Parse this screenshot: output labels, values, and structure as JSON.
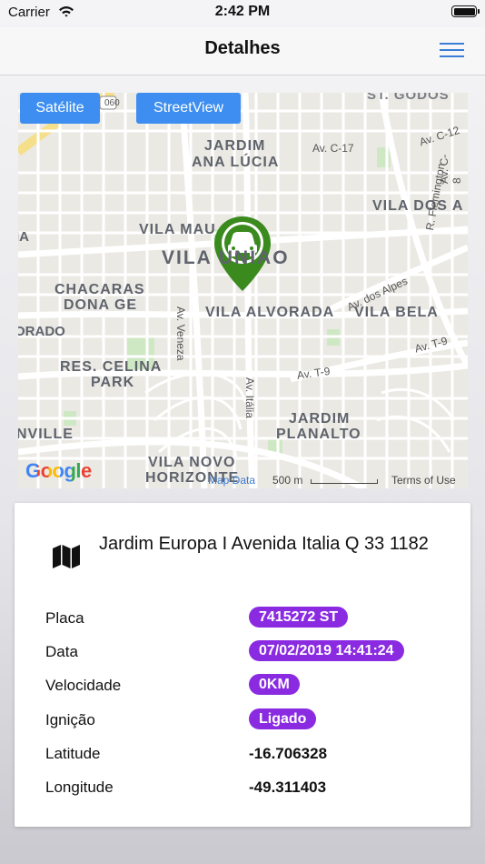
{
  "status_bar": {
    "carrier": "Carrier",
    "time": "2:42 PM"
  },
  "nav": {
    "title": "Detalhes"
  },
  "map": {
    "satellite_label": "Satélite",
    "streetview_label": "StreetView",
    "google_logo": "Google",
    "map_data": "Map Data",
    "scale": "500 m",
    "terms": "Terms of Use",
    "labels": {
      "jardim_ana_lucia_1": "JARDIM",
      "jardim_ana_lucia_2": "ANA LÚCIA",
      "vila_mau": "VILA MAU",
      "vila_uniao": "VILA UNIAO",
      "chacaras_1": "CHACARAS",
      "chacaras_2": "DONA GE",
      "vila_alvorada": "VILA ALVORADA",
      "vila_bela": "VILA BELA",
      "vila_dos_a": "VILA DOS A",
      "orado": "ORADO",
      "res_celina_1": "RES. CELINA",
      "res_celina_2": "PARK",
      "jardim_planalto_1": "JARDIM",
      "jardim_planalto_2": "PLANALTO",
      "nville": "NVILLE",
      "vila_novo_1": "VILA NOVO",
      "vila_novo_2": "HORIZONTE",
      "av_c17": "Av. C-17",
      "av_c12": "Av. C-12",
      "av_c8": "Av. C-8",
      "av_dos_alpes": "Av. dos Alpes",
      "r_flemington": "R. Flemington",
      "av_t9_1": "Av. T-9",
      "av_t9_2": "Av. T-9",
      "av_veneza": "Av. Veneza",
      "av_italia": "Av. Itália",
      "road_060": "060",
      "st_godoi": "ST. GODOS",
      "ia": "IA"
    }
  },
  "details": {
    "address": "Jardim Europa I Avenida Italia Q 33 1182",
    "rows": [
      {
        "label": "Placa",
        "value": "7415272 ST"
      },
      {
        "label": "Data",
        "value": "07/02/2019 14:41:24"
      },
      {
        "label": "Velocidade",
        "value": "0KM"
      },
      {
        "label": "Ignição",
        "value": "Ligado"
      },
      {
        "label": "Latitude",
        "value": "-16.706328"
      },
      {
        "label": "Longitude",
        "value": "-49.311403"
      }
    ]
  },
  "colors": {
    "accent": "#3d8ef0",
    "pill": "#8a2be2",
    "marker": "#3a8a1e"
  }
}
